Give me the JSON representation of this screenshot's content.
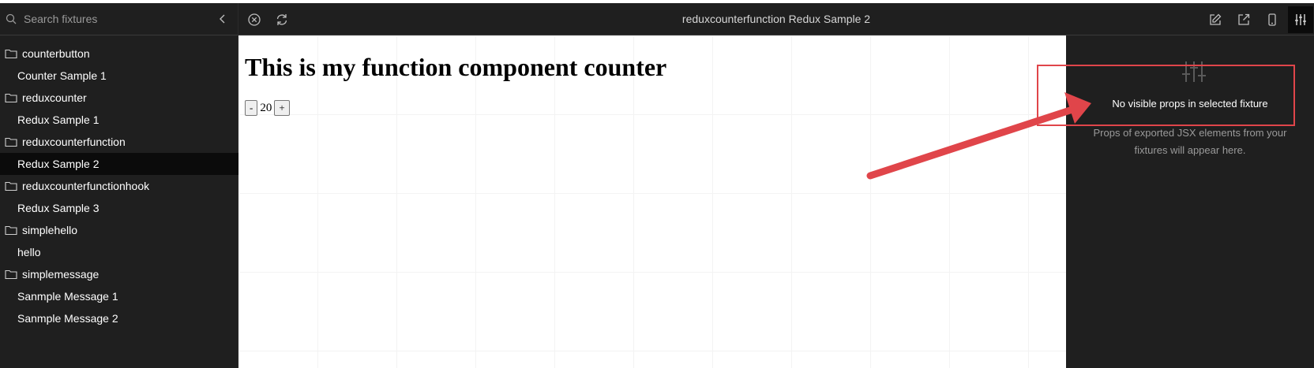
{
  "sidebar": {
    "search_placeholder": "Search fixtures",
    "tree": [
      {
        "type": "folder",
        "label": "counterbutton"
      },
      {
        "type": "item",
        "label": "Counter Sample 1"
      },
      {
        "type": "folder",
        "label": "reduxcounter"
      },
      {
        "type": "item",
        "label": "Redux Sample 1"
      },
      {
        "type": "folder",
        "label": "reduxcounterfunction"
      },
      {
        "type": "item",
        "label": "Redux Sample 2",
        "selected": true
      },
      {
        "type": "folder",
        "label": "reduxcounterfunctionhook"
      },
      {
        "type": "item",
        "label": "Redux Sample 3"
      },
      {
        "type": "folder",
        "label": "simplehello"
      },
      {
        "type": "item",
        "label": "hello"
      },
      {
        "type": "folder",
        "label": "simplemessage"
      },
      {
        "type": "item",
        "label": "Sanmple Message 1"
      },
      {
        "type": "item",
        "label": "Sanmple Message 2"
      }
    ]
  },
  "topbar": {
    "title": "reduxcounterfunction Redux Sample 2",
    "icons": [
      "close-circle-icon",
      "refresh-icon",
      "edit-icon",
      "external-link-icon",
      "mobile-icon",
      "sliders-icon"
    ]
  },
  "preview": {
    "heading": "This is my function component counter",
    "decrement_label": "-",
    "count": "20",
    "increment_label": "+"
  },
  "props_panel": {
    "heading": "No visible props in selected fixture",
    "description": "Props of exported JSX elements from your fixtures will appear here."
  },
  "colors": {
    "annotation_red": "#e0454a",
    "panel_bg": "#1f1f1f",
    "selected_row": "#0b0b0b"
  }
}
